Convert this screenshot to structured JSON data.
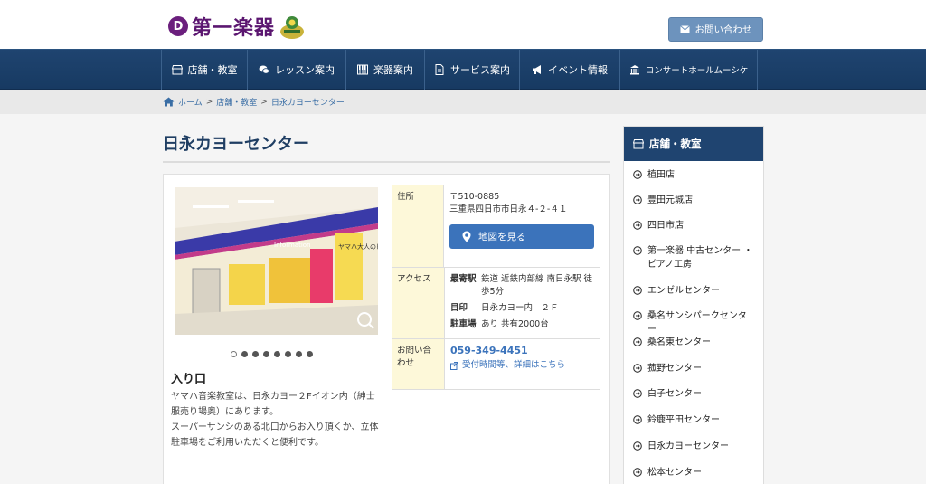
{
  "header": {
    "logo_text": "第一楽器",
    "contact_button": "お問い合わせ"
  },
  "nav": [
    {
      "label": "店舗・教室",
      "icon": "store-icon"
    },
    {
      "label": "レッスン案内",
      "icon": "chat-icon"
    },
    {
      "label": "楽器案内",
      "icon": "piano-icon"
    },
    {
      "label": "サービス案内",
      "icon": "document-icon"
    },
    {
      "label": "イベント情報",
      "icon": "megaphone-icon"
    },
    {
      "label": "コンサートホールムーシケ",
      "icon": "hall-icon"
    }
  ],
  "breadcrumb": {
    "home": "ホーム",
    "section": "店舗・教室",
    "current": "日永カヨーセンター",
    "separator": ">"
  },
  "page": {
    "title": "日永カヨーセンター"
  },
  "gallery": {
    "caption_title": "入り口",
    "caption_lines": [
      "ヤマハ音楽教室は、日永カヨー２Fイオン内（紳士服売り場奥）にあります。",
      "スーパーサンシのある北口からお入り頂くか、立体駐車場をご利用いただくと便利です。"
    ],
    "photo_text": "ヤマハ大人のピアノレッスン",
    "photo_sign": "Information",
    "dot_count": 8,
    "active_dot": 0
  },
  "info": {
    "address_label": "住所",
    "postal": "〒510-0885",
    "address": "三重県四日市市日永４-２-４１",
    "map_button": "地図を見る",
    "access_label": "アクセス",
    "station_label": "最寄駅",
    "station": "鉄道 近鉄内部線 南日永駅 徒歩5分",
    "landmark_label": "目印",
    "landmark": "日永カヨー内　２Ｆ",
    "parking_label": "駐車場",
    "parking": "あり 共有2000台",
    "contact_label": "お問い合わせ",
    "phone": "059-349-4451",
    "hours_link": "受付時間等、詳細はこちら"
  },
  "sidebar": {
    "title": "店舗・教室",
    "items": [
      "植田店",
      "豊田元城店",
      "四日市店",
      "第一楽器 中古センター ・ ピアノ工房",
      "エンゼルセンター",
      "桑名サンシパークセンター",
      "桑名東センター",
      "菰野センター",
      "白子センター",
      "鈴鹿平田センター",
      "日永カヨーセンター",
      "松本センター"
    ]
  },
  "colors": {
    "nav_bg": "#1f4470",
    "accent_blue": "#3b73bb",
    "logo_purple": "#5b1670",
    "table_header_bg": "#fdf8d9"
  }
}
